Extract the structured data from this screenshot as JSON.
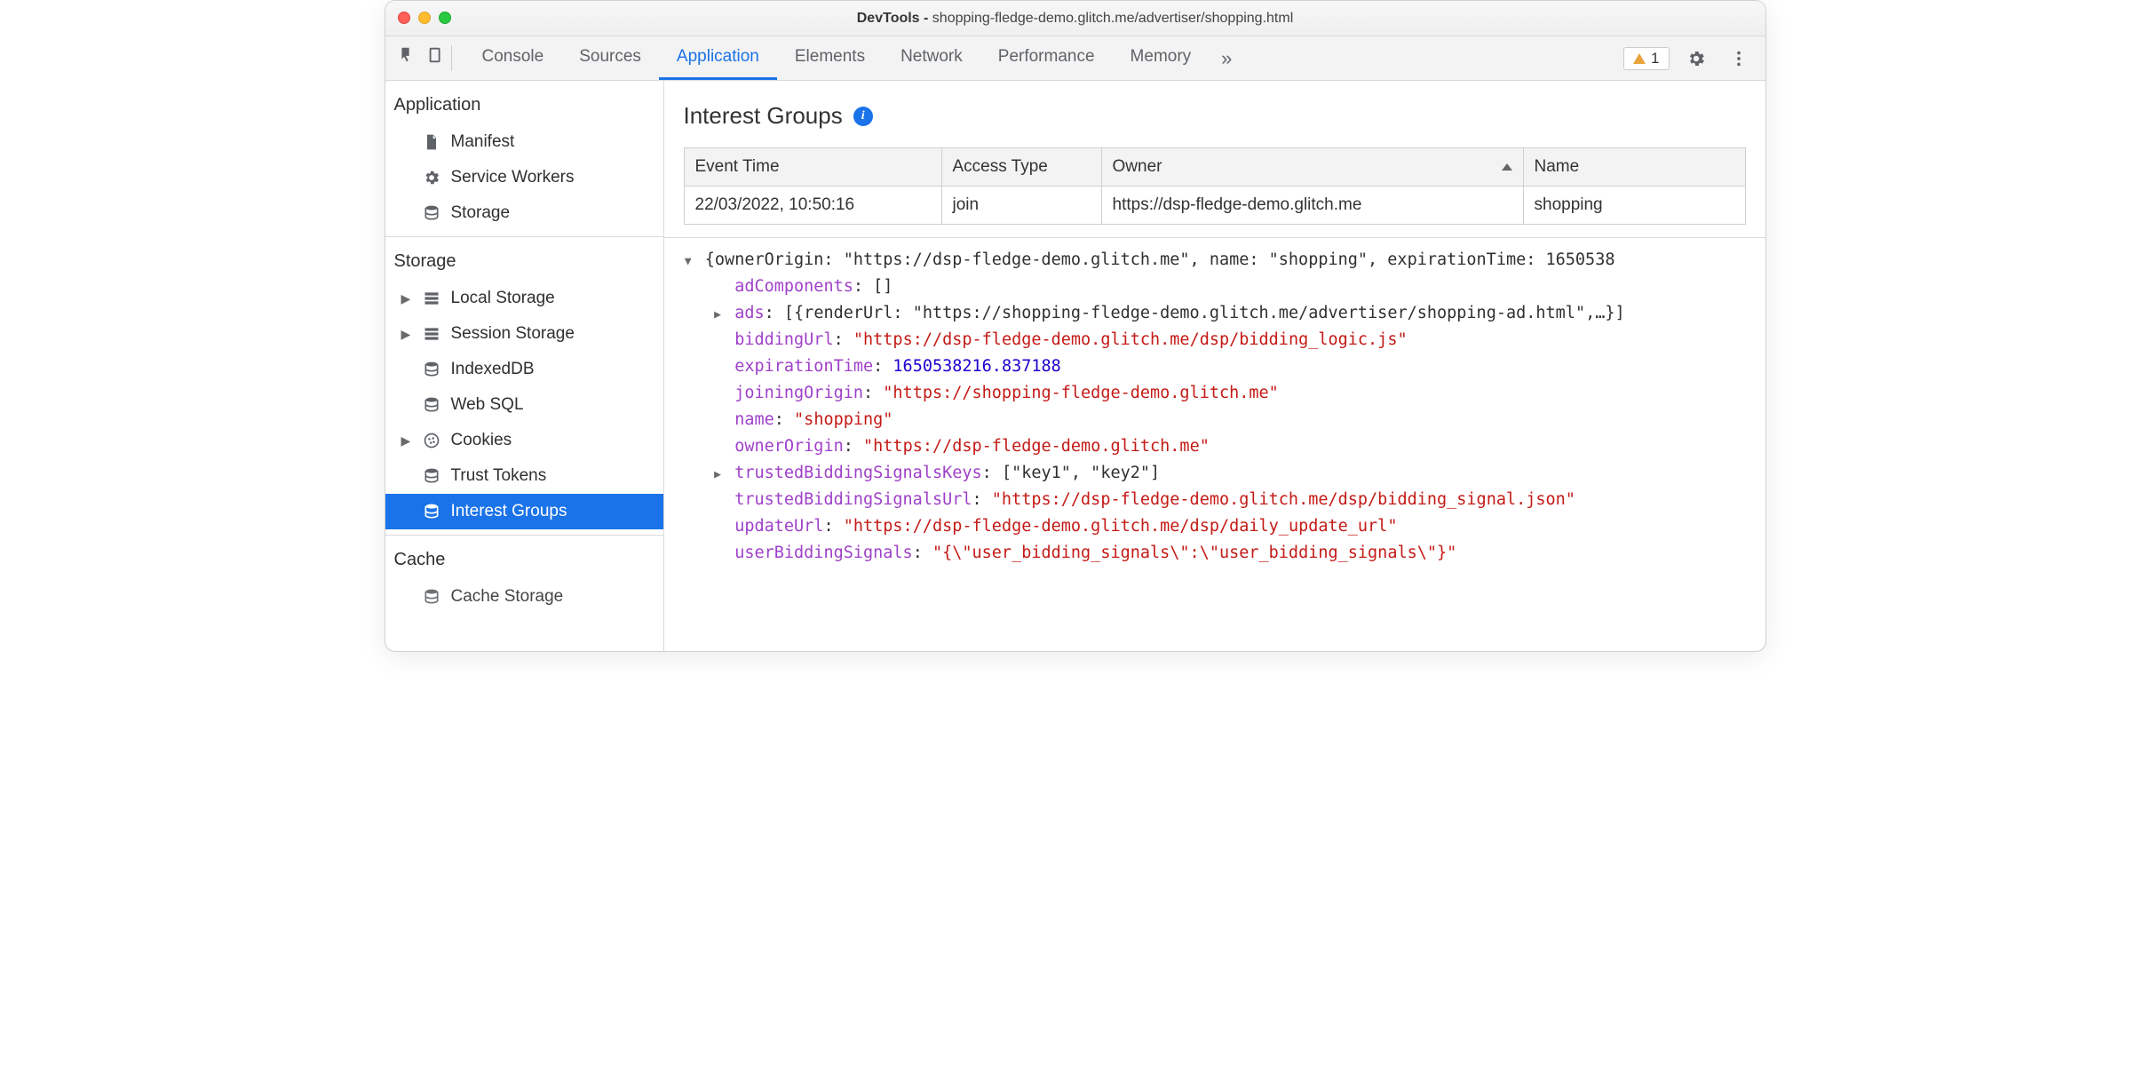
{
  "window": {
    "title_prefix": "DevTools - ",
    "title_url": "shopping-fledge-demo.glitch.me/advertiser/shopping.html"
  },
  "tabs": {
    "items": [
      "Console",
      "Sources",
      "Application",
      "Elements",
      "Network",
      "Performance",
      "Memory"
    ],
    "active_index": 2,
    "overflow_glyph": "»",
    "warning_count": "1"
  },
  "sidebar": {
    "application": {
      "header": "Application",
      "items": [
        "Manifest",
        "Service Workers",
        "Storage"
      ]
    },
    "storage": {
      "header": "Storage",
      "items": [
        {
          "label": "Local Storage",
          "expandable": true
        },
        {
          "label": "Session Storage",
          "expandable": true
        },
        {
          "label": "IndexedDB",
          "expandable": false
        },
        {
          "label": "Web SQL",
          "expandable": false
        },
        {
          "label": "Cookies",
          "expandable": true
        },
        {
          "label": "Trust Tokens",
          "expandable": false
        },
        {
          "label": "Interest Groups",
          "expandable": false,
          "selected": true
        }
      ]
    },
    "cache": {
      "header": "Cache",
      "items": [
        "Cache Storage"
      ]
    }
  },
  "panel": {
    "title": "Interest Groups",
    "table": {
      "headers": [
        "Event Time",
        "Access Type",
        "Owner",
        "Name"
      ],
      "sort_col": 2,
      "rows": [
        {
          "event_time": "22/03/2022, 10:50:16",
          "access_type": "join",
          "owner": "https://dsp-fledge-demo.glitch.me",
          "name": "shopping"
        }
      ]
    },
    "json": {
      "top_line": "{ownerOrigin: \"https://dsp-fledge-demo.glitch.me\", name: \"shopping\", expirationTime: 1650538",
      "adComponents_key": "adComponents",
      "adComponents_val": "[]",
      "ads_key": "ads",
      "ads_val": "[{renderUrl: \"https://shopping-fledge-demo.glitch.me/advertiser/shopping-ad.html\",…}]",
      "biddingUrl_key": "biddingUrl",
      "biddingUrl_val": "\"https://dsp-fledge-demo.glitch.me/dsp/bidding_logic.js\"",
      "expirationTime_key": "expirationTime",
      "expirationTime_val": "1650538216.837188",
      "joiningOrigin_key": "joiningOrigin",
      "joiningOrigin_val": "\"https://shopping-fledge-demo.glitch.me\"",
      "name_key": "name",
      "name_val": "\"shopping\"",
      "ownerOrigin_key": "ownerOrigin",
      "ownerOrigin_val": "\"https://dsp-fledge-demo.glitch.me\"",
      "tbsKeys_key": "trustedBiddingSignalsKeys",
      "tbsKeys_val": "[\"key1\", \"key2\"]",
      "tbsUrl_key": "trustedBiddingSignalsUrl",
      "tbsUrl_val": "\"https://dsp-fledge-demo.glitch.me/dsp/bidding_signal.json\"",
      "updateUrl_key": "updateUrl",
      "updateUrl_val": "\"https://dsp-fledge-demo.glitch.me/dsp/daily_update_url\"",
      "userBiddingSignals_key": "userBiddingSignals",
      "userBiddingSignals_val": "\"{\\\"user_bidding_signals\\\":\\\"user_bidding_signals\\\"}\""
    }
  }
}
